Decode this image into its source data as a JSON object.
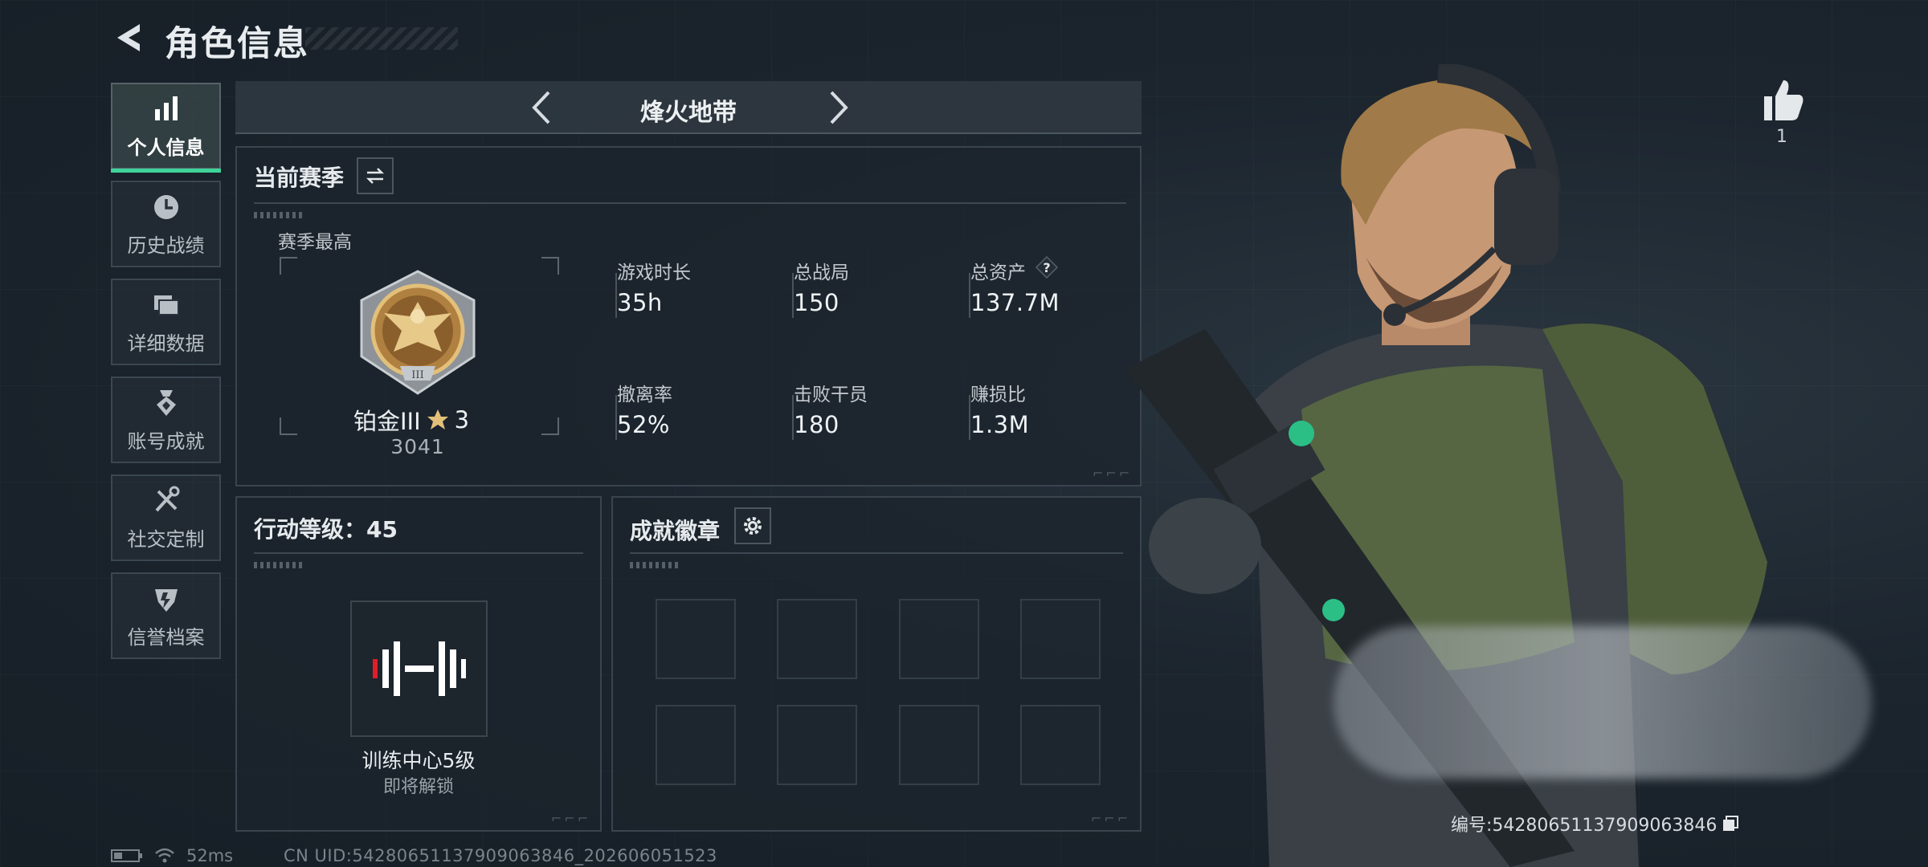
{
  "header": {
    "title": "角色信息"
  },
  "sidebar": {
    "items": [
      {
        "label": "个人信息",
        "icon": "bar-chart-icon",
        "active": true
      },
      {
        "label": "历史战绩",
        "icon": "clock-icon",
        "active": false
      },
      {
        "label": "详细数据",
        "icon": "folder-icon",
        "active": false
      },
      {
        "label": "账号成就",
        "icon": "medal-icon",
        "active": false
      },
      {
        "label": "社交定制",
        "icon": "tools-icon",
        "active": false
      },
      {
        "label": "信誉档案",
        "icon": "shield-icon",
        "active": false
      }
    ]
  },
  "mode": {
    "name": "烽火地带"
  },
  "season": {
    "title": "当前赛季",
    "best_label": "赛季最高",
    "rank_name": "铂金III",
    "rank_stars": "3",
    "rank_score": "3041",
    "stats": [
      {
        "label": "游戏时长",
        "value": "35h"
      },
      {
        "label": "总战局",
        "value": "150"
      },
      {
        "label": "总资产",
        "value": "137.7M",
        "has_help": true
      },
      {
        "label": "撤离率",
        "value": "52%"
      },
      {
        "label": "击败干员",
        "value": "180"
      },
      {
        "label": "赚损比",
        "value": "1.3M"
      }
    ]
  },
  "action_level": {
    "title": "行动等级：45",
    "training_name": "训练中心5级",
    "training_status": "即将解锁"
  },
  "achievements": {
    "title": "成就徽章",
    "slot_count": 8
  },
  "likes": {
    "count": "1"
  },
  "player": {
    "id_text": "编号:5428065113790906384​6"
  },
  "status": {
    "ping": "52ms",
    "uid": "CN UID:54280651137909063846_202606051523"
  },
  "colors": {
    "accent": "#3ed39a",
    "panel_border": "#39444e"
  }
}
